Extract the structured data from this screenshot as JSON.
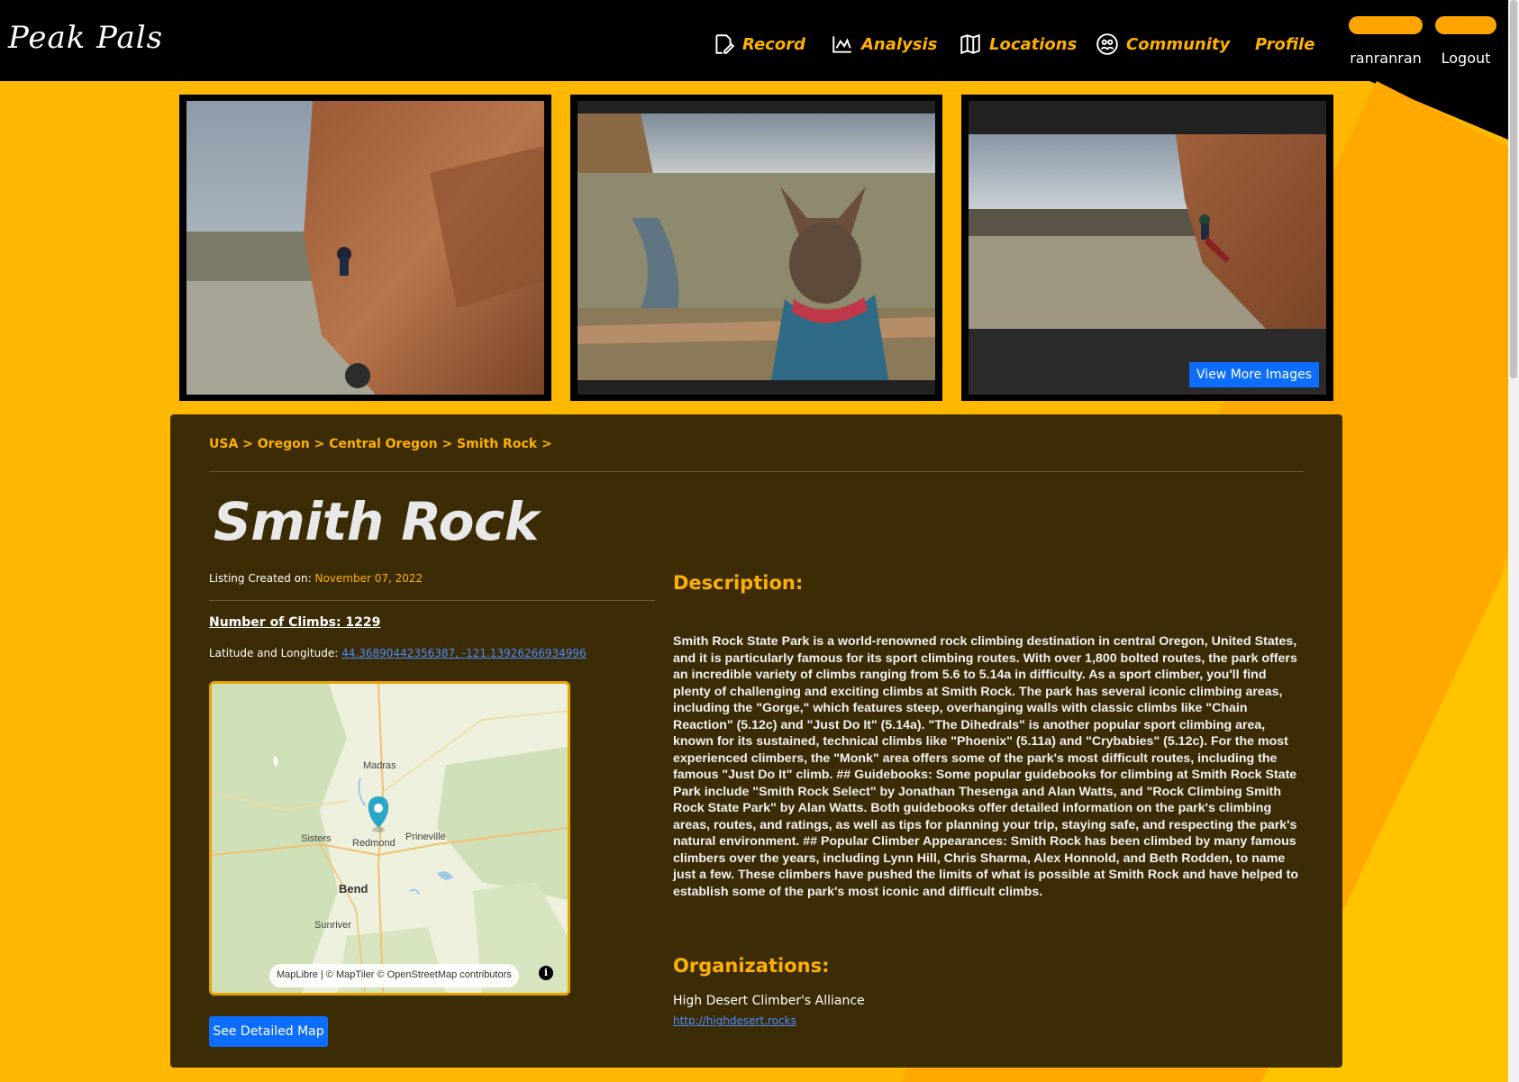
{
  "header": {
    "logo": "Peak Pals",
    "nav": [
      {
        "label": "Record",
        "icon": "record-icon"
      },
      {
        "label": "Analysis",
        "icon": "analysis-icon"
      },
      {
        "label": "Locations",
        "icon": "locations-icon"
      },
      {
        "label": "Community",
        "icon": "community-icon"
      },
      {
        "label": "Profile",
        "icon": ""
      }
    ],
    "username": "ranranran",
    "logout": "Logout"
  },
  "gallery": {
    "view_more": "View More Images"
  },
  "breadcrumb": [
    "USA",
    "Oregon",
    "Central Oregon",
    "Smith Rock"
  ],
  "breadcrumb_separator": ">",
  "title": "Smith Rock",
  "listing": {
    "created_label": "Listing Created on:",
    "created_date": "November 07, 2022",
    "climbs_label": "Number of Climbs: 1229",
    "latlng_label": "Latitude and Longitude:",
    "latlng_value": "44.36890442356387, -121.13926266934996"
  },
  "map": {
    "labels": {
      "madras": "Madras",
      "sisters": "Sisters",
      "redmond": "Redmond",
      "prineville": "Prineville",
      "bend": "Bend",
      "sunriver": "Sunriver"
    },
    "attribution": "MapLibre | © MapTiler © OpenStreetMap contributors",
    "see_map": "See Detailed Map"
  },
  "description": {
    "heading": "Description:",
    "text": "Smith Rock State Park is a world-renowned rock climbing destination in central Oregon, United States, and it is particularly famous for its sport climbing routes. With over 1,800 bolted routes, the park offers an incredible variety of climbs ranging from 5.6 to 5.14a in difficulty. As a sport climber, you'll find plenty of challenging and exciting climbs at Smith Rock. The park has several iconic climbing areas, including the \"Gorge,\" which features steep, overhanging walls with classic climbs like \"Chain Reaction\" (5.12c) and \"Just Do It\" (5.14a). \"The Dihedrals\" is another popular sport climbing area, known for its sustained, technical climbs like \"Phoenix\" (5.11a) and \"Crybabies\" (5.12c). For the most experienced climbers, the \"Monk\" area offers some of the park's most difficult routes, including the famous \"Just Do It\" climb. ## Guidebooks: Some popular guidebooks for climbing at Smith Rock State Park include \"Smith Rock Select\" by Jonathan Thesenga and Alan Watts, and \"Rock Climbing Smith Rock State Park\" by Alan Watts. Both guidebooks offer detailed information on the park's climbing areas, routes, and ratings, as well as tips for planning your trip, staying safe, and respecting the park's natural environment. ## Popular Climber Appearances: Smith Rock has been climbed by many famous climbers over the years, including Lynn Hill, Chris Sharma, Alex Honnold, and Beth Rodden, to name just a few. These climbers have pushed the limits of what is possible at Smith Rock and have helped to establish some of the park's most iconic and difficult climbs."
  },
  "organizations": {
    "heading": "Organizations:",
    "name": "High Desert Climber's Alliance",
    "link": "http://highdesert.rocks"
  }
}
